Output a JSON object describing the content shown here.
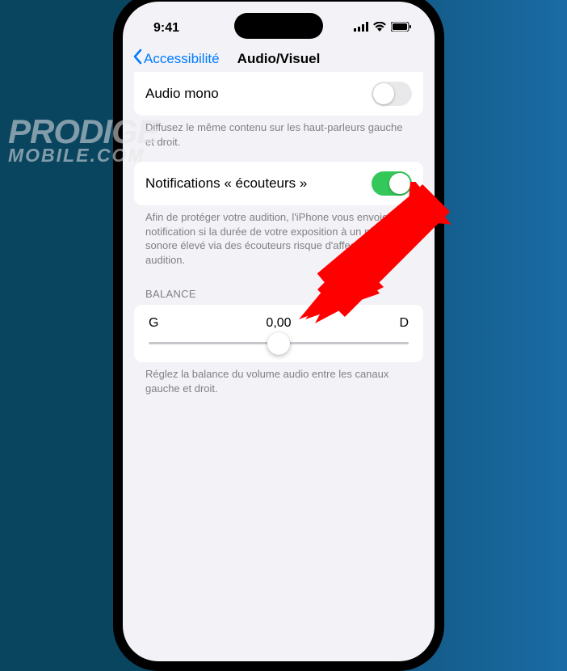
{
  "status": {
    "time": "9:41"
  },
  "nav": {
    "back": "Accessibilité",
    "title": "Audio/Visuel"
  },
  "mono": {
    "label": "Audio mono",
    "desc": "Diffusez le même contenu sur les haut-parleurs gauche et droit."
  },
  "notif": {
    "label": "Notifications « écouteurs »",
    "desc": "Afin de protéger votre audition, l'iPhone vous envoie une notification si la durée de votre exposition à un niveau sonore élevé via des écouteurs risque d'affecter votre audition."
  },
  "balance": {
    "header": "BALANCE",
    "left": "G",
    "value": "0,00",
    "right": "D",
    "desc": "Réglez la balance du volume audio entre les canaux gauche et droit."
  },
  "watermark": {
    "line1": "PRODIGE",
    "line2": "MOBILE.COM"
  }
}
